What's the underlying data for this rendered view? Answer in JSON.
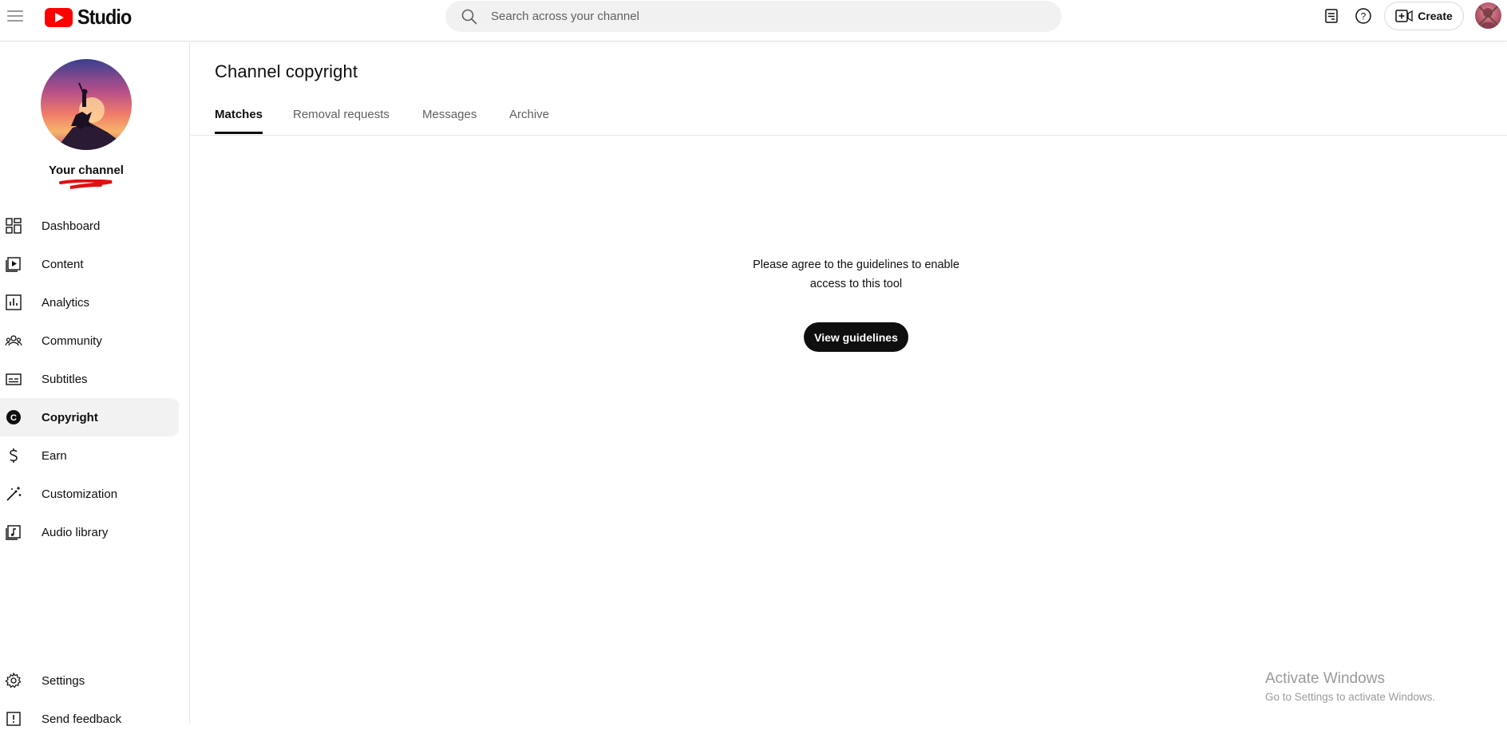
{
  "header": {
    "logo_text": "Studio",
    "search_placeholder": "Search across your channel",
    "create_label": "Create"
  },
  "sidebar": {
    "channel_name": "Your channel",
    "items": [
      {
        "label": "Dashboard",
        "icon": "dashboard-icon"
      },
      {
        "label": "Content",
        "icon": "content-icon"
      },
      {
        "label": "Analytics",
        "icon": "analytics-icon"
      },
      {
        "label": "Community",
        "icon": "community-icon"
      },
      {
        "label": "Subtitles",
        "icon": "subtitles-icon"
      },
      {
        "label": "Copyright",
        "icon": "copyright-icon",
        "active": true
      },
      {
        "label": "Earn",
        "icon": "earn-icon"
      },
      {
        "label": "Customization",
        "icon": "customization-icon"
      },
      {
        "label": "Audio library",
        "icon": "audio-library-icon"
      }
    ],
    "footer_items": [
      {
        "label": "Settings",
        "icon": "gear-icon"
      },
      {
        "label": "Send feedback",
        "icon": "feedback-icon"
      }
    ]
  },
  "main": {
    "title": "Channel copyright",
    "tabs": [
      {
        "label": "Matches",
        "active": true
      },
      {
        "label": "Removal requests"
      },
      {
        "label": "Messages"
      },
      {
        "label": "Archive"
      }
    ],
    "message_line1": "Please agree to the guidelines to enable",
    "message_line2": "access to this tool",
    "button_label": "View guidelines"
  },
  "watermark": {
    "line1": "Activate Windows",
    "line2": "Go to Settings to activate Windows."
  },
  "colors": {
    "brand_red": "#ff0000",
    "text_primary": "#0f0f0f",
    "text_secondary": "#606060",
    "active_bg": "#f2f2f2"
  }
}
